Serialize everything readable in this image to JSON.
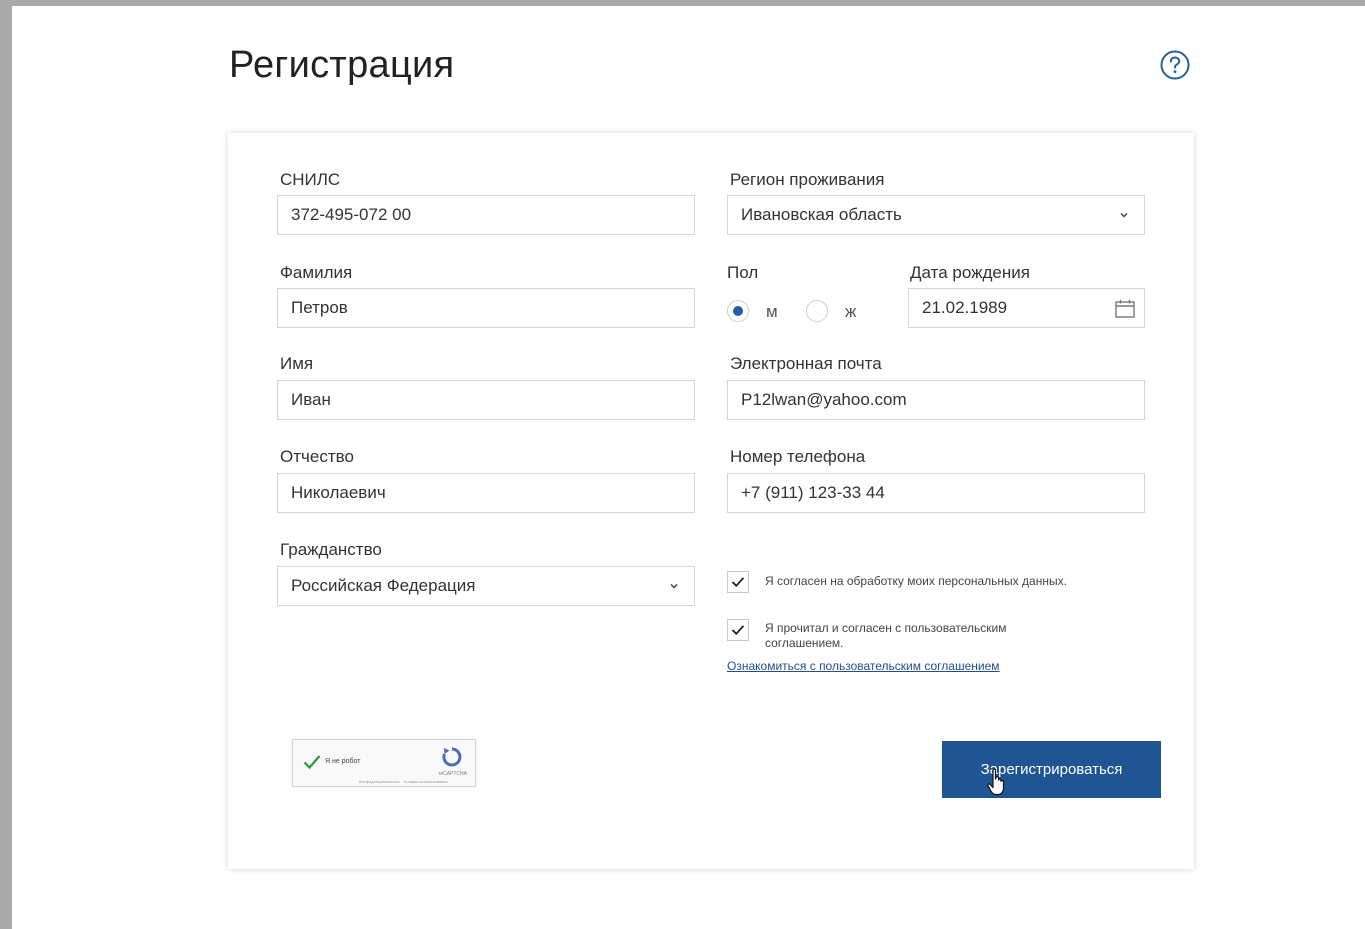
{
  "page": {
    "title": "Регистрация",
    "help_icon": "question-circle-icon"
  },
  "form": {
    "snils": {
      "label": "СНИЛС",
      "value": "372-495-072 00"
    },
    "region": {
      "label": "Регион проживания",
      "value": "Ивановская область"
    },
    "surname": {
      "label": "Фамилия",
      "value": "Петров"
    },
    "gender": {
      "label": "Пол",
      "options": [
        {
          "label": "м",
          "checked": true
        },
        {
          "label": "ж",
          "checked": false
        }
      ]
    },
    "birthdate": {
      "label": "Дата рождения",
      "value": "21.02.1989",
      "icon": "calendar-icon"
    },
    "name": {
      "label": "Имя",
      "value": "Иван"
    },
    "email": {
      "label": "Электронная почта",
      "value": "P12lwan@yahoo.com"
    },
    "patronymic": {
      "label": "Отчество",
      "value": "Николаевич"
    },
    "phone": {
      "label": "Номер телефона",
      "value": "+7 (911) 123-33 44"
    },
    "citizenship": {
      "label": "Гражданство",
      "value": "Российская Федерация"
    },
    "consent_personal_data": {
      "label": "Я согласен на обработку моих персональных данных.",
      "checked": true
    },
    "consent_agreement": {
      "label": "Я прочитал и согласен с пользовательским соглашением.",
      "checked": true
    },
    "agreement_link": "Ознакомиться с пользовательским соглашением",
    "captcha": {
      "label": "Я не робот",
      "brand": "reCAPTCHA",
      "footer": "Конфиденциальность - Условия использования"
    },
    "submit_label": "Зарегистрироваться"
  },
  "colors": {
    "accent": "#1f5592",
    "radio_checked": "#1f5eab",
    "border": "#d6d6d6"
  }
}
